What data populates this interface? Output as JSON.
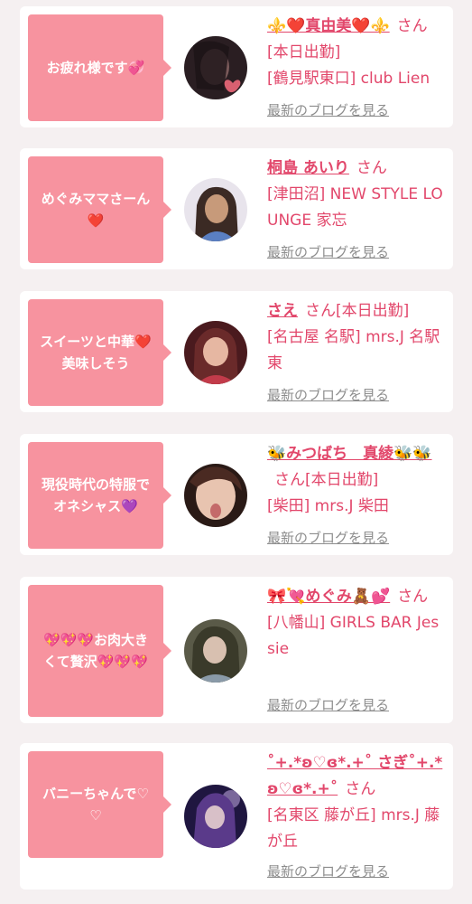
{
  "posts": [
    {
      "message": "お疲れ様です💞",
      "name": "⚜️❤️真由美❤️⚜️",
      "suffix": "さん[本日出勤]",
      "shop": "[鶴見駅東口] club Lien",
      "blog_link": "最新のブログを見る",
      "avatar_colors": [
        "#2a1e22",
        "#7a5a5a",
        "#d86070"
      ]
    },
    {
      "message": "めぐみママさーん❤️",
      "name": "桐島 あいり",
      "suffix": "さん",
      "shop": "[津田沼] NEW STYLE LOUNGE 家忘",
      "blog_link": "最新のブログを見る",
      "avatar_colors": [
        "#3b2a24",
        "#c79a7a",
        "#5a7fc2"
      ]
    },
    {
      "message": "スイーツと中華❤️美味しそう",
      "name": "さえ",
      "suffix": "さん[本日出勤]",
      "shop": "[名古屋 名駅] mrs.J 名駅東",
      "blog_link": "最新のブログを見る",
      "avatar_colors": [
        "#6a2a2a",
        "#e6b7a2",
        "#c23b4a"
      ]
    },
    {
      "message": "現役時代の特服でオネシャス💜",
      "name": "🐝みつばち　真綾🐝🐝",
      "suffix": "さん[本日出勤]",
      "shop": "[柴田] mrs.J 柴田",
      "blog_link": "最新のブログを見る",
      "avatar_colors": [
        "#4a2a22",
        "#e8c4b0",
        "#c46a6a"
      ]
    },
    {
      "message": "💖💖💖お肉大きくて贅沢💖💖💖",
      "name": "🎀💘めぐみ🧸💕",
      "suffix": "さん",
      "shop": "[八幡山] GIRLS BAR Jessie",
      "blog_link": "最新のブログを見る",
      "avatar_colors": [
        "#3a3a2a",
        "#d8c0b0",
        "#8a9aa8"
      ]
    },
    {
      "message": "バニーちゃんで♡♡",
      "name": "˚+.*ʚ♡ɞ*.+˚ さぎ˚+.*ʚ♡ɞ*.+˚",
      "suffix": "さん",
      "shop": "[名東区 藤が丘] mrs.J 藤が丘",
      "blog_link": "最新のブログを見る",
      "avatar_colors": [
        "#1f1640",
        "#5a3a8a",
        "#b8a0d8"
      ]
    }
  ]
}
